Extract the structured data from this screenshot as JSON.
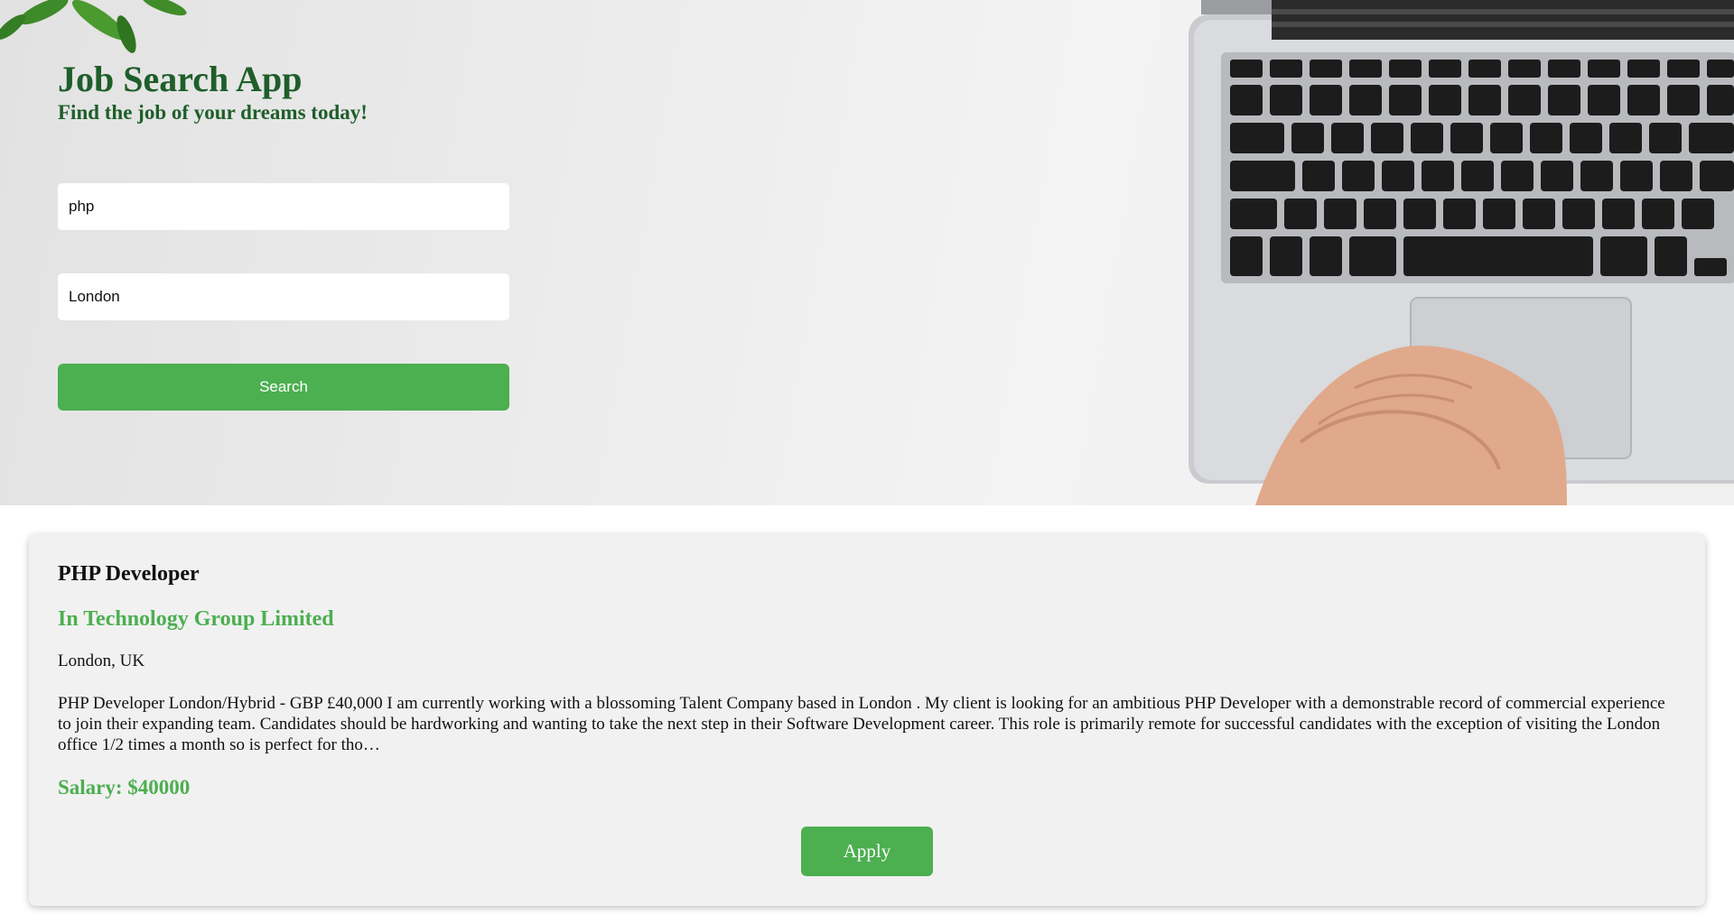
{
  "header": {
    "title": "Job Search App",
    "subtitle": "Find the job of your dreams today!"
  },
  "search": {
    "keyword_value": "php",
    "location_value": "London",
    "button_label": "Search"
  },
  "results": [
    {
      "title": "PHP Developer",
      "company": "In Technology Group Limited",
      "location": "London, UK",
      "description": "PHP Developer London/Hybrid - GBP £40,000 I am currently working with a blossoming Talent Company based in London . My client is looking for an ambitious PHP Developer with a demonstrable record of commercial experience to join their expanding team. Candidates should be hardworking and wanting to take the next step in their Software Development career. This role is primarily remote for successful candidates with the exception of visiting the London office 1/2 times a month so is perfect for tho…",
      "salary": "Salary: $40000",
      "apply_label": "Apply"
    }
  ],
  "colors": {
    "accent": "#4caf50",
    "title_green": "#1e5e2a",
    "card_bg": "#f1f1f1"
  },
  "icons": [
    "plant-leaves-decoration",
    "laptop-photo"
  ]
}
